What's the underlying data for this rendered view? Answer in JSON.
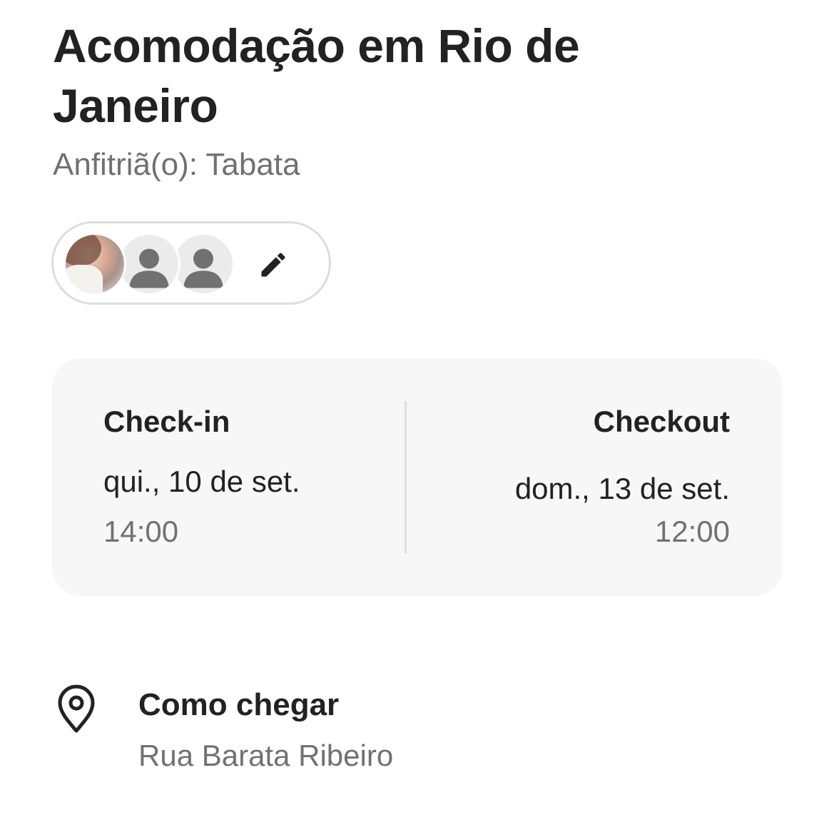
{
  "listing": {
    "title": "Acomodação em Rio de Janeiro",
    "host": "Anfitriã(o): Tabata"
  },
  "guests": {
    "avatars": [
      "guest-photo",
      "default-avatar-icon",
      "default-avatar-icon"
    ],
    "edit_icon": "pencil-icon"
  },
  "dates": {
    "checkin": {
      "label": "Check-in",
      "date": "qui., 10 de set.",
      "time": "14:00"
    },
    "checkout": {
      "label": "Checkout",
      "date": "dom., 13 de set.",
      "time": "12:00"
    }
  },
  "directions": {
    "icon": "map-pin-icon",
    "title": "Como chegar",
    "address": "Rua Barata Ribeiro"
  },
  "colors": {
    "text_primary": "#222222",
    "text_secondary": "#717171",
    "card_background": "#f7f7f7",
    "border": "#dddddd"
  }
}
